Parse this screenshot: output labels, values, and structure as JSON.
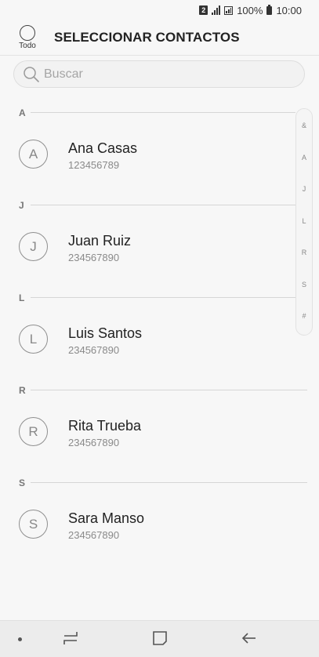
{
  "status": {
    "sim": "2",
    "battery": "100%",
    "time": "10:00"
  },
  "header": {
    "all_label": "Todo",
    "title": "SELECCIONAR CONTACTOS"
  },
  "search": {
    "placeholder": "Buscar"
  },
  "sections": [
    {
      "letter": "A",
      "contacts": [
        {
          "initial": "A",
          "name": "Ana Casas",
          "phone": "123456789"
        }
      ]
    },
    {
      "letter": "J",
      "contacts": [
        {
          "initial": "J",
          "name": "Juan Ruiz",
          "phone": "234567890"
        }
      ]
    },
    {
      "letter": "L",
      "contacts": [
        {
          "initial": "L",
          "name": "Luis Santos",
          "phone": "234567890"
        }
      ]
    },
    {
      "letter": "R",
      "contacts": [
        {
          "initial": "R",
          "name": "Rita Trueba",
          "phone": "234567890"
        }
      ]
    },
    {
      "letter": "S",
      "contacts": [
        {
          "initial": "S",
          "name": "Sara Manso",
          "phone": "234567890"
        }
      ]
    }
  ],
  "index_bar": [
    "&",
    "A",
    "J",
    "L",
    "R",
    "S",
    "#"
  ],
  "navbar": {
    "icons": [
      "dot-icon",
      "recent-apps-icon",
      "home-icon",
      "back-icon"
    ]
  }
}
